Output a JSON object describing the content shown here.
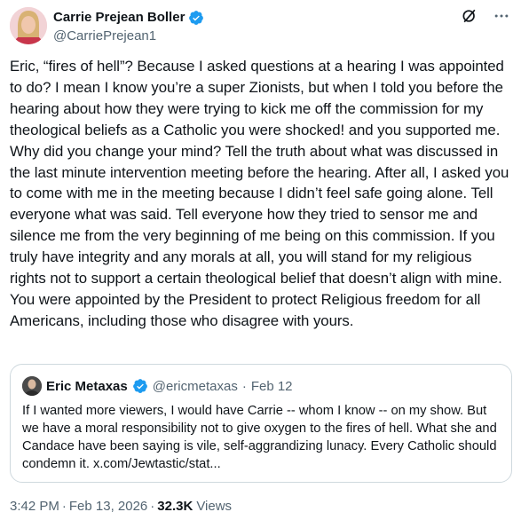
{
  "author": {
    "display_name": "Carrie Prejean Boller",
    "handle": "@CarriePrejean1",
    "verified_color": "#1d9bf0"
  },
  "header_icons": [
    "grok-icon",
    "more-icon"
  ],
  "tweet": {
    "text": "Eric, “fires of hell”? Because I asked questions at a hearing I was appointed to do? I mean I know you’re a super Zionists, but when I told you before the hearing about how they were trying to kick me off the commission for my theological beliefs as a Catholic you were shocked! and you supported me. Why did you change your mind? Tell the truth about what was discussed in the last minute intervention meeting before the hearing. After all, I asked you to come with me in the meeting because I didn’t feel safe going alone. Tell everyone what was said. Tell everyone how they tried to sensor me and silence me from the very beginning of me being on this commission. If you truly have integrity and any morals at all, you will stand for my religious rights not to support a certain theological belief that doesn’t align with mine. You were appointed by the President to protect Religious freedom for all Americans, including those who disagree with yours."
  },
  "quote": {
    "display_name": "Eric Metaxas",
    "handle": "@ericmetaxas",
    "dot": "·",
    "date": "Feb 12",
    "text": "If I wanted more viewers, I would have Carrie -- whom I know -- on my show. But we have a moral responsibility not to give oxygen to the fires of hell. What she and Candace have been saying is vile, self-aggrandizing lunacy. Every Catholic should condemn it. x.com/Jewtastic/stat..."
  },
  "footer": {
    "time": "3:42 PM",
    "dot": "·",
    "date": "Feb 13, 2026",
    "views_count": "32.3K",
    "views_label": "Views"
  }
}
